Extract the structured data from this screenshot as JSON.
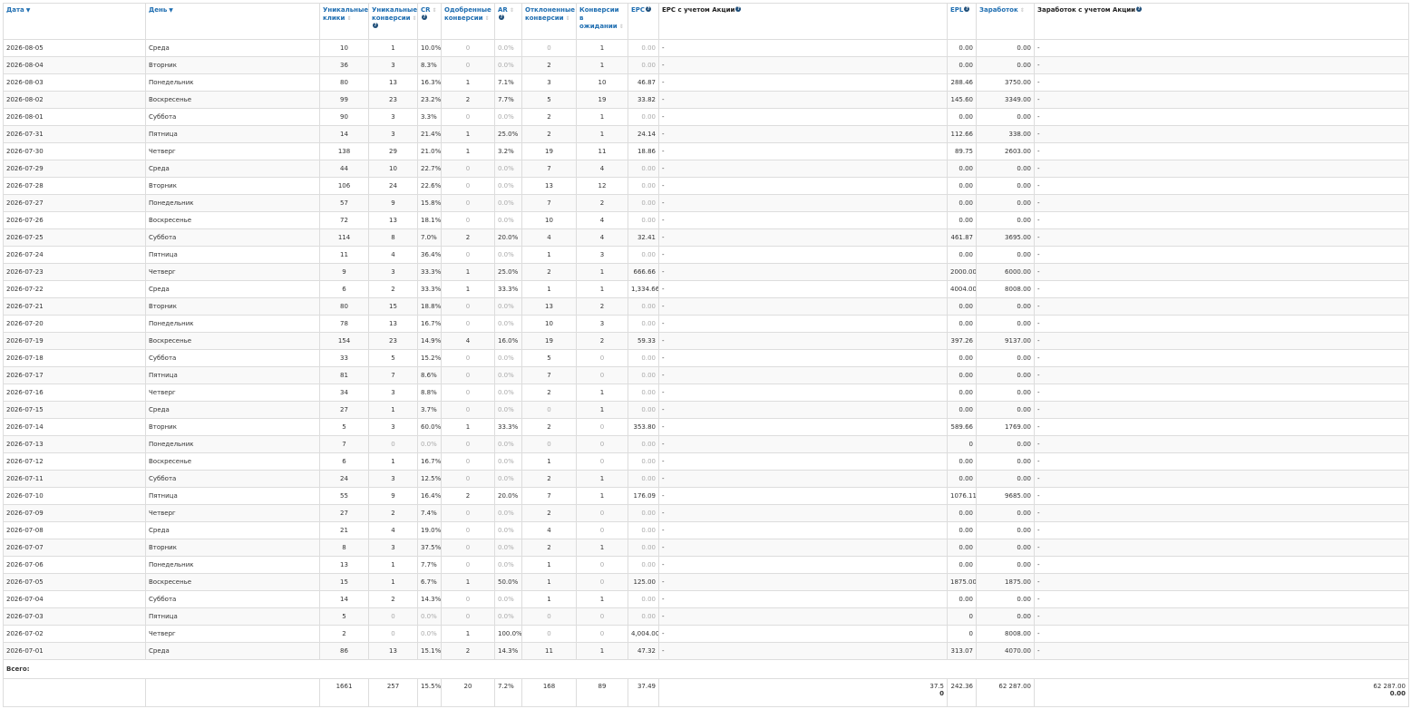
{
  "columns": [
    {
      "key": "date",
      "label": "Дата",
      "sort": "active",
      "help": false
    },
    {
      "key": "day",
      "label": "День",
      "sort": "active",
      "help": false
    },
    {
      "key": "clicks",
      "label": "Уникальные клики",
      "sort": "neutral",
      "help": false
    },
    {
      "key": "conv",
      "label": "Уникальные конверсии",
      "sort": "neutral",
      "help": true
    },
    {
      "key": "cr",
      "label": "CR",
      "sort": "neutral",
      "help": true
    },
    {
      "key": "appr",
      "label": "Одобренные конверсии",
      "sort": "neutral",
      "help": false
    },
    {
      "key": "ar",
      "label": "AR",
      "sort": "neutral",
      "help": true
    },
    {
      "key": "rej",
      "label": "Отклоненные конверсии",
      "sort": "neutral",
      "help": false
    },
    {
      "key": "pend",
      "label": "Конверсии в ожидании",
      "sort": "neutral",
      "help": false
    },
    {
      "key": "epc",
      "label": "EPC",
      "sort": "none",
      "help": true
    },
    {
      "key": "epc_promo",
      "label": "EPC с учетом Акции",
      "sort": "none",
      "help": true,
      "plain": true
    },
    {
      "key": "epl",
      "label": "EPL",
      "sort": "none",
      "help": true
    },
    {
      "key": "earn",
      "label": "Заработок",
      "sort": "neutral",
      "help": false
    },
    {
      "key": "earn_promo",
      "label": "Заработок с учетом Акции",
      "sort": "none",
      "help": true,
      "plain": true
    }
  ],
  "rows": [
    [
      "2026-08-05",
      "Среда",
      "10",
      "1",
      "10.0%",
      "0",
      "0.0%",
      "0",
      "1",
      "0.00",
      "-",
      "0.00",
      "0.00",
      "-"
    ],
    [
      "2026-08-04",
      "Вторник",
      "36",
      "3",
      "8.3%",
      "0",
      "0.0%",
      "2",
      "1",
      "0.00",
      "-",
      "0.00",
      "0.00",
      "-"
    ],
    [
      "2026-08-03",
      "Понедельник",
      "80",
      "13",
      "16.3%",
      "1",
      "7.1%",
      "3",
      "10",
      "46.87",
      "-",
      "288.46",
      "3750.00",
      "-"
    ],
    [
      "2026-08-02",
      "Воскресенье",
      "99",
      "23",
      "23.2%",
      "2",
      "7.7%",
      "5",
      "19",
      "33.82",
      "-",
      "145.60",
      "3349.00",
      "-"
    ],
    [
      "2026-08-01",
      "Суббота",
      "90",
      "3",
      "3.3%",
      "0",
      "0.0%",
      "2",
      "1",
      "0.00",
      "-",
      "0.00",
      "0.00",
      "-"
    ],
    [
      "2026-07-31",
      "Пятница",
      "14",
      "3",
      "21.4%",
      "1",
      "25.0%",
      "2",
      "1",
      "24.14",
      "-",
      "112.66",
      "338.00",
      "-"
    ],
    [
      "2026-07-30",
      "Четверг",
      "138",
      "29",
      "21.0%",
      "1",
      "3.2%",
      "19",
      "11",
      "18.86",
      "-",
      "89.75",
      "2603.00",
      "-"
    ],
    [
      "2026-07-29",
      "Среда",
      "44",
      "10",
      "22.7%",
      "0",
      "0.0%",
      "7",
      "4",
      "0.00",
      "-",
      "0.00",
      "0.00",
      "-"
    ],
    [
      "2026-07-28",
      "Вторник",
      "106",
      "24",
      "22.6%",
      "0",
      "0.0%",
      "13",
      "12",
      "0.00",
      "-",
      "0.00",
      "0.00",
      "-"
    ],
    [
      "2026-07-27",
      "Понедельник",
      "57",
      "9",
      "15.8%",
      "0",
      "0.0%",
      "7",
      "2",
      "0.00",
      "-",
      "0.00",
      "0.00",
      "-"
    ],
    [
      "2026-07-26",
      "Воскресенье",
      "72",
      "13",
      "18.1%",
      "0",
      "0.0%",
      "10",
      "4",
      "0.00",
      "-",
      "0.00",
      "0.00",
      "-"
    ],
    [
      "2026-07-25",
      "Суббота",
      "114",
      "8",
      "7.0%",
      "2",
      "20.0%",
      "4",
      "4",
      "32.41",
      "-",
      "461.87",
      "3695.00",
      "-"
    ],
    [
      "2026-07-24",
      "Пятница",
      "11",
      "4",
      "36.4%",
      "0",
      "0.0%",
      "1",
      "3",
      "0.00",
      "-",
      "0.00",
      "0.00",
      "-"
    ],
    [
      "2026-07-23",
      "Четверг",
      "9",
      "3",
      "33.3%",
      "1",
      "25.0%",
      "2",
      "1",
      "666.66",
      "-",
      "2000.00",
      "6000.00",
      "-"
    ],
    [
      "2026-07-22",
      "Среда",
      "6",
      "2",
      "33.3%",
      "1",
      "33.3%",
      "1",
      "1",
      "1,334.66",
      "-",
      "4004.00",
      "8008.00",
      "-"
    ],
    [
      "2026-07-21",
      "Вторник",
      "80",
      "15",
      "18.8%",
      "0",
      "0.0%",
      "13",
      "2",
      "0.00",
      "-",
      "0.00",
      "0.00",
      "-"
    ],
    [
      "2026-07-20",
      "Понедельник",
      "78",
      "13",
      "16.7%",
      "0",
      "0.0%",
      "10",
      "3",
      "0.00",
      "-",
      "0.00",
      "0.00",
      "-"
    ],
    [
      "2026-07-19",
      "Воскресенье",
      "154",
      "23",
      "14.9%",
      "4",
      "16.0%",
      "19",
      "2",
      "59.33",
      "-",
      "397.26",
      "9137.00",
      "-"
    ],
    [
      "2026-07-18",
      "Суббота",
      "33",
      "5",
      "15.2%",
      "0",
      "0.0%",
      "5",
      "0",
      "0.00",
      "-",
      "0.00",
      "0.00",
      "-"
    ],
    [
      "2026-07-17",
      "Пятница",
      "81",
      "7",
      "8.6%",
      "0",
      "0.0%",
      "7",
      "0",
      "0.00",
      "-",
      "0.00",
      "0.00",
      "-"
    ],
    [
      "2026-07-16",
      "Четверг",
      "34",
      "3",
      "8.8%",
      "0",
      "0.0%",
      "2",
      "1",
      "0.00",
      "-",
      "0.00",
      "0.00",
      "-"
    ],
    [
      "2026-07-15",
      "Среда",
      "27",
      "1",
      "3.7%",
      "0",
      "0.0%",
      "0",
      "1",
      "0.00",
      "-",
      "0.00",
      "0.00",
      "-"
    ],
    [
      "2026-07-14",
      "Вторник",
      "5",
      "3",
      "60.0%",
      "1",
      "33.3%",
      "2",
      "0",
      "353.80",
      "-",
      "589.66",
      "1769.00",
      "-"
    ],
    [
      "2026-07-13",
      "Понедельник",
      "7",
      "0",
      "0.0%",
      "0",
      "0.0%",
      "0",
      "0",
      "0.00",
      "-",
      "0",
      "0.00",
      "-"
    ],
    [
      "2026-07-12",
      "Воскресенье",
      "6",
      "1",
      "16.7%",
      "0",
      "0.0%",
      "1",
      "0",
      "0.00",
      "-",
      "0.00",
      "0.00",
      "-"
    ],
    [
      "2026-07-11",
      "Суббота",
      "24",
      "3",
      "12.5%",
      "0",
      "0.0%",
      "2",
      "1",
      "0.00",
      "-",
      "0.00",
      "0.00",
      "-"
    ],
    [
      "2026-07-10",
      "Пятница",
      "55",
      "9",
      "16.4%",
      "2",
      "20.0%",
      "7",
      "1",
      "176.09",
      "-",
      "1076.11",
      "9685.00",
      "-"
    ],
    [
      "2026-07-09",
      "Четверг",
      "27",
      "2",
      "7.4%",
      "0",
      "0.0%",
      "2",
      "0",
      "0.00",
      "-",
      "0.00",
      "0.00",
      "-"
    ],
    [
      "2026-07-08",
      "Среда",
      "21",
      "4",
      "19.0%",
      "0",
      "0.0%",
      "4",
      "0",
      "0.00",
      "-",
      "0.00",
      "0.00",
      "-"
    ],
    [
      "2026-07-07",
      "Вторник",
      "8",
      "3",
      "37.5%",
      "0",
      "0.0%",
      "2",
      "1",
      "0.00",
      "-",
      "0.00",
      "0.00",
      "-"
    ],
    [
      "2026-07-06",
      "Понедельник",
      "13",
      "1",
      "7.7%",
      "0",
      "0.0%",
      "1",
      "0",
      "0.00",
      "-",
      "0.00",
      "0.00",
      "-"
    ],
    [
      "2026-07-05",
      "Воскресенье",
      "15",
      "1",
      "6.7%",
      "1",
      "50.0%",
      "1",
      "0",
      "125.00",
      "-",
      "1875.00",
      "1875.00",
      "-"
    ],
    [
      "2026-07-04",
      "Суббота",
      "14",
      "2",
      "14.3%",
      "0",
      "0.0%",
      "1",
      "1",
      "0.00",
      "-",
      "0.00",
      "0.00",
      "-"
    ],
    [
      "2026-07-03",
      "Пятница",
      "5",
      "0",
      "0.0%",
      "0",
      "0.0%",
      "0",
      "0",
      "0.00",
      "-",
      "0",
      "0.00",
      "-"
    ],
    [
      "2026-07-02",
      "Четверг",
      "2",
      "0",
      "0.0%",
      "1",
      "100.0%",
      "0",
      "0",
      "4,004.00",
      "-",
      "0",
      "8008.00",
      "-"
    ],
    [
      "2026-07-01",
      "Среда",
      "86",
      "13",
      "15.1%",
      "2",
      "14.3%",
      "11",
      "1",
      "47.32",
      "-",
      "313.07",
      "4070.00",
      "-"
    ]
  ],
  "totals": {
    "label": "Всего:",
    "values": [
      "",
      "",
      "1661",
      "257",
      "15.5%",
      "20",
      "7.2%",
      "168",
      "89",
      "37.49",
      "37.5",
      "242.36",
      "62 287.00",
      "62 287.00"
    ],
    "epc_promo_line2": "0",
    "earn_promo_line2": "0.00"
  }
}
